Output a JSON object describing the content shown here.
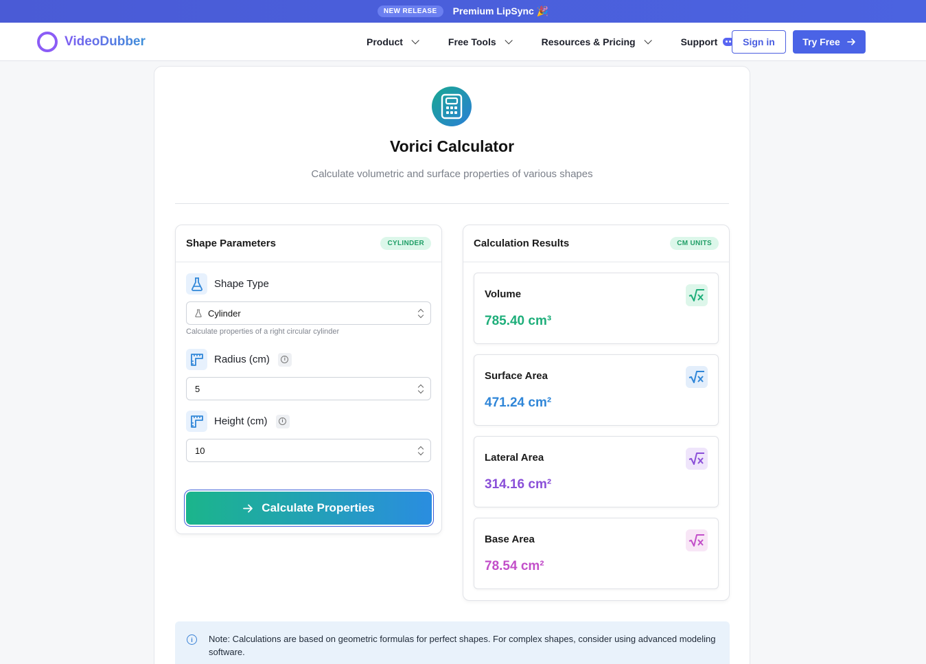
{
  "announcement": {
    "badge": "NEW RELEASE",
    "message": "Premium LipSync 🎉"
  },
  "nav": {
    "brand": "VideoDubber",
    "links": [
      "Product",
      "Free Tools",
      "Resources & Pricing"
    ],
    "support": "Support",
    "sign_in": "Sign in",
    "try_free": "Try Free"
  },
  "page": {
    "title": "Vorici Calculator",
    "subtitle": "Calculate volumetric and surface properties of various shapes"
  },
  "params": {
    "title": "Shape Parameters",
    "badge": "CYLINDER",
    "shape_label": "Shape Type",
    "shape_value": "Cylinder",
    "shape_hint": "Calculate properties of a right circular cylinder",
    "radius_label": "Radius (cm)",
    "radius_value": "5",
    "height_label": "Height (cm)",
    "height_value": "10",
    "button": "Calculate Properties"
  },
  "results": {
    "title": "Calculation Results",
    "badge": "CM UNITS",
    "items": [
      {
        "name": "Volume",
        "value": "785.40 cm³",
        "color": "#1eae7a",
        "bg": "#ddf6ea"
      },
      {
        "name": "Surface Area",
        "value": "471.24 cm²",
        "color": "#2f86d8",
        "bg": "#e3eefb"
      },
      {
        "name": "Lateral Area",
        "value": "314.16 cm²",
        "color": "#8a4fd8",
        "bg": "#efe5fb"
      },
      {
        "name": "Base Area",
        "value": "78.54 cm²",
        "color": "#c24fc9",
        "bg": "#f8e6f6"
      }
    ]
  },
  "note": "Note: Calculations are based on geometric formulas for perfect shapes. For complex shapes, consider using advanced modeling software."
}
